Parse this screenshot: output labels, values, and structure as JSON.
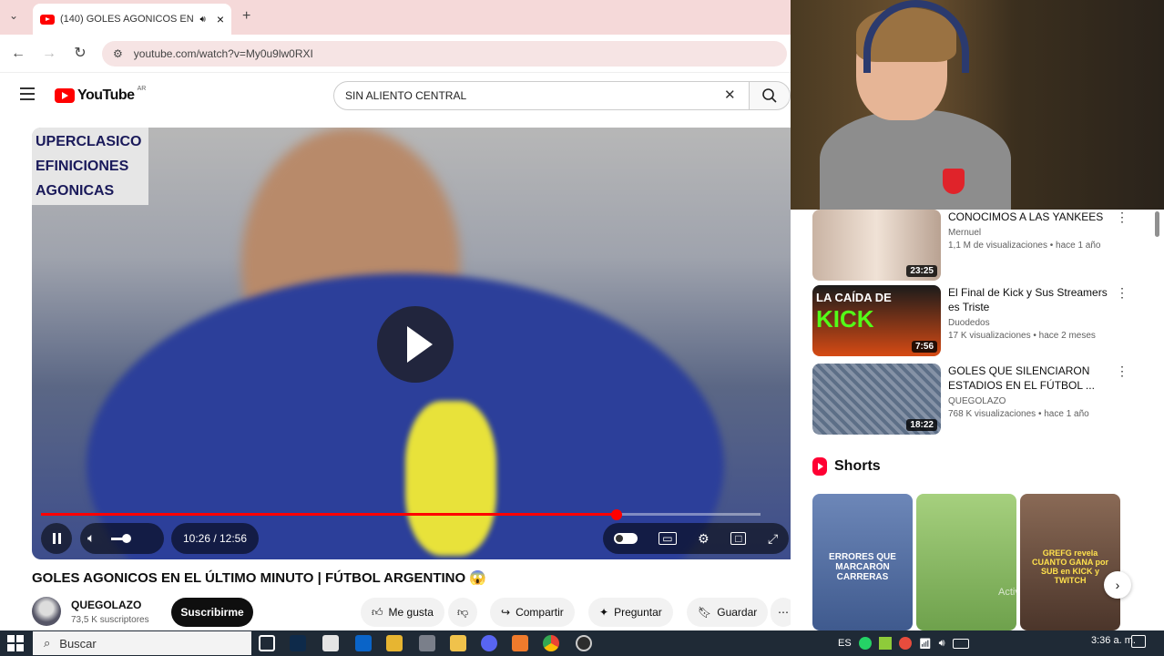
{
  "browser": {
    "tab_title": "(140) GOLES AGONICOS EN",
    "url": "youtube.com/watch?v=My0u9lw0RXI",
    "tab_audio_icon": "speaker-icon",
    "new_tab_symbol": "+",
    "close_symbol": "×"
  },
  "youtube": {
    "logo_text": "YouTube",
    "country_code": "AR",
    "search_value": "SIN ALIENTO CENTRAL",
    "clear_symbol": "✕"
  },
  "player": {
    "overlay_lines": [
      "UPERCLASICO",
      "EFINICIONES",
      "AGONICAS"
    ],
    "time_display": "10:26 / 12:56",
    "progress_fraction": 0.8
  },
  "video": {
    "title": "GOLES AGONICOS EN EL ÚLTIMO MINUTO | FÚTBOL ARGENTINO 😱",
    "channel": "QUEGOLAZO",
    "subscribers": "73,5 K suscriptores",
    "subscribe_label": "Suscribirme",
    "like_label": "Me gusta",
    "share_label": "Compartir",
    "ask_label": "Preguntar",
    "save_label": "Guardar"
  },
  "recommendations": [
    {
      "title": "CONOCIMOS A LAS YANKEES",
      "channel": "Mernuel",
      "meta": "1,1 M de visualizaciones • hace 1 año",
      "duration": "23:25",
      "color": "#d8c6b8"
    },
    {
      "title": "El Final de Kick y Sus Streamers es Triste",
      "channel": "Duodedos",
      "meta": "17 K visualizaciones • hace 2 meses",
      "duration": "7:56",
      "color": "#1f1f1f",
      "thumb_text_1": "LA CAÍDA DE",
      "thumb_text_2": "KICK"
    },
    {
      "title": "GOLES QUE SILENCIARON ESTADIOS EN EL FÚTBOL ...",
      "channel": "QUEGOLAZO",
      "meta": "768 K visualizaciones • hace 1 año",
      "duration": "18:22",
      "color": "#6d7d90"
    }
  ],
  "shorts": {
    "heading": "Shorts",
    "items": [
      {
        "caption": "ERRORES QUE MARCARON CARRERAS",
        "color": "#4d6fa8"
      },
      {
        "caption": "",
        "color": "#8fbf6a"
      },
      {
        "caption": "GREFG revela CUANTO GANA por SUB en KICK y TWITCH",
        "color": "#7a5a48"
      }
    ],
    "watermark": "Activar Windo"
  },
  "taskbar": {
    "search_placeholder": "Buscar",
    "lang": "ES",
    "time": "3:36 a. m."
  }
}
